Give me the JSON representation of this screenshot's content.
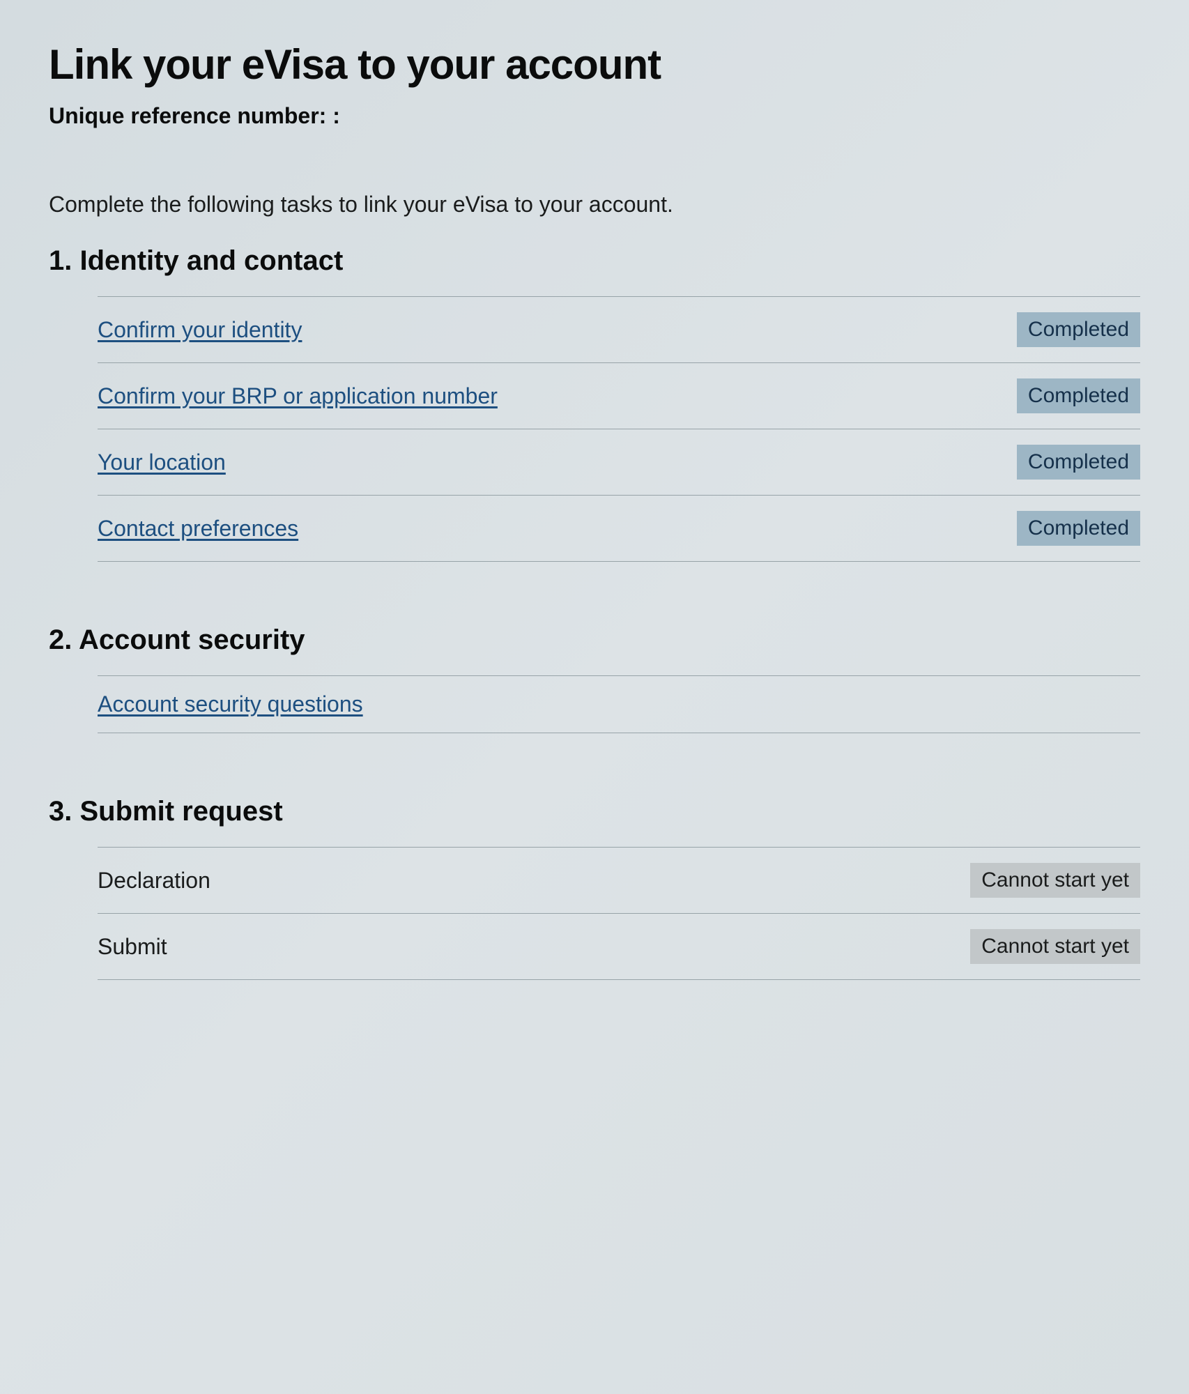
{
  "page_title": "Link your eVisa to your account",
  "reference_label": "Unique reference number: :",
  "intro": "Complete the following tasks to link your eVisa to your account.",
  "sections": [
    {
      "heading": "Identity and contact",
      "tasks": [
        {
          "label": "Confirm your identity",
          "status": "Completed",
          "link": true,
          "status_class": "completed"
        },
        {
          "label": "Confirm your BRP or application number",
          "status": "Completed",
          "link": true,
          "status_class": "completed"
        },
        {
          "label": "Your location",
          "status": "Completed",
          "link": true,
          "status_class": "completed"
        },
        {
          "label": "Contact preferences",
          "status": "Completed",
          "link": true,
          "status_class": "completed"
        }
      ]
    },
    {
      "heading": "Account security",
      "tasks": [
        {
          "label": "Account security questions",
          "status": "",
          "link": true,
          "status_class": ""
        }
      ]
    },
    {
      "heading": "Submit request",
      "tasks": [
        {
          "label": "Declaration",
          "status": "Cannot start yet",
          "link": false,
          "status_class": "cannot"
        },
        {
          "label": "Submit",
          "status": "Cannot start yet",
          "link": false,
          "status_class": "cannot"
        }
      ]
    }
  ]
}
